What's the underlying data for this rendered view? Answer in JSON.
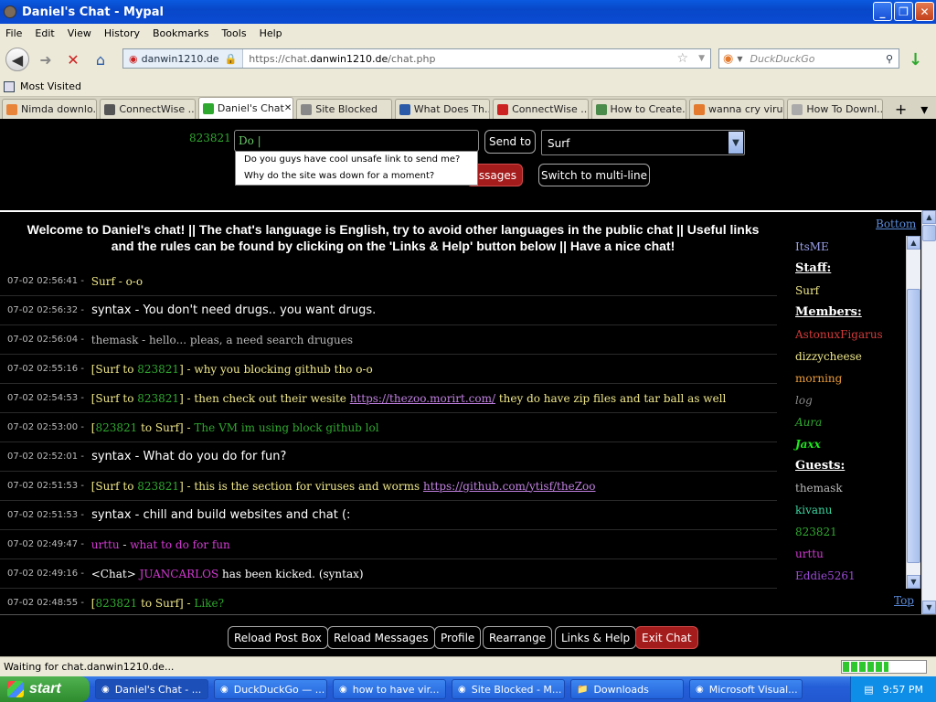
{
  "window": {
    "title": "Daniel's Chat - Mypal"
  },
  "menu": [
    "File",
    "Edit",
    "View",
    "History",
    "Bookmarks",
    "Tools",
    "Help"
  ],
  "nav": {
    "site_identity": "danwin1210.de",
    "url_prefix": "https://chat.",
    "url_domain": "danwin1210.de",
    "url_path": "/chat.php",
    "search_placeholder": "DuckDuckGo"
  },
  "bookmarks": {
    "most_visited": "Most Visited"
  },
  "tabs": [
    {
      "label": "Nimda downlo...",
      "active": false
    },
    {
      "label": "ConnectWise ...",
      "active": false
    },
    {
      "label": "Daniel's Chat",
      "active": true
    },
    {
      "label": "Site Blocked",
      "active": false
    },
    {
      "label": "What Does Th...",
      "active": false
    },
    {
      "label": "ConnectWise ...",
      "active": false
    },
    {
      "label": "How to Create...",
      "active": false
    },
    {
      "label": "wanna cry viru...",
      "active": false
    },
    {
      "label": "How To Downl...",
      "active": false
    }
  ],
  "postbox": {
    "username": "823821 :",
    "input_value": "Do |",
    "suggestions": [
      "Do you guys have cool unsafe link to send me?",
      "Why do the site was down for a moment?"
    ],
    "send_label": "Send to",
    "recipient": "Surf",
    "messages_btn": "ssages",
    "multiline_btn": "Switch to multi-line"
  },
  "welcome": "Welcome to Daniel's chat! || The chat's language is English, try to avoid other languages in the public chat || Useful links and the rules can be found by clicking on the 'Links & Help' button below || Have a nice chat!",
  "messages": [
    {
      "ts": "07-02 02:56:41 -",
      "parts": [
        {
          "t": " Surf - o-o",
          "c": "#f0e88a"
        }
      ]
    },
    {
      "ts": "07-02 02:56:32 -",
      "sans": true,
      "parts": [
        {
          "t": " syntax - You don't need drugs.. you want drugs.",
          "c": "#ffffff"
        }
      ]
    },
    {
      "ts": "07-02 02:56:04 -",
      "parts": [
        {
          "t": " themask - hello... pleas, a need search drugues",
          "c": "#b8b8b8"
        }
      ]
    },
    {
      "ts": "07-02 02:55:16 -",
      "parts": [
        {
          "t": " [Surf to ",
          "c": "#f0e88a"
        },
        {
          "t": "823821",
          "c": "#2fa82f"
        },
        {
          "t": "] - why you blocking github tho o-o",
          "c": "#f0e88a"
        }
      ]
    },
    {
      "ts": "07-02 02:54:53 -",
      "parts": [
        {
          "t": " [Surf to ",
          "c": "#f0e88a"
        },
        {
          "t": "823821",
          "c": "#2fa82f"
        },
        {
          "t": "] - then check out their wesite ",
          "c": "#f0e88a"
        },
        {
          "t": "https://thezoo.morirt.com/",
          "c": "#c080e0",
          "link": true
        },
        {
          "t": " they do have zip files and tar ball as well",
          "c": "#f0e88a"
        }
      ]
    },
    {
      "ts": "07-02 02:53:00 -",
      "parts": [
        {
          "t": " [",
          "c": "#f0e88a"
        },
        {
          "t": "823821",
          "c": "#2fa82f"
        },
        {
          "t": " to Surf] - ",
          "c": "#f0e88a"
        },
        {
          "t": "The VM im using block github lol",
          "c": "#2fa82f"
        }
      ]
    },
    {
      "ts": "07-02 02:52:01 -",
      "sans": true,
      "parts": [
        {
          "t": " syntax - What do you do for fun?",
          "c": "#ffffff"
        }
      ]
    },
    {
      "ts": "07-02 02:51:53 -",
      "parts": [
        {
          "t": " [Surf to ",
          "c": "#f0e88a"
        },
        {
          "t": "823821",
          "c": "#2fa82f"
        },
        {
          "t": "] - this is the section for viruses and worms ",
          "c": "#f0e88a"
        },
        {
          "t": "https://github.com/ytisf/theZoo",
          "c": "#c080e0",
          "link": true
        }
      ]
    },
    {
      "ts": "07-02 02:51:53 -",
      "sans": true,
      "parts": [
        {
          "t": " syntax - chill and build websites and chat (:",
          "c": "#ffffff"
        }
      ]
    },
    {
      "ts": "07-02 02:49:47 -",
      "parts": [
        {
          "t": " urttu",
          "c": "#d43ad4"
        },
        {
          "t": " - ",
          "c": "#ddd"
        },
        {
          "t": "what to do for fun",
          "c": "#d43ad4"
        }
      ]
    },
    {
      "ts": "07-02 02:49:16 -",
      "parts": [
        {
          "t": " <Chat> ",
          "c": "#ffffff"
        },
        {
          "t": "JUANCARLOS",
          "c": "#d43ad4"
        },
        {
          "t": " has been kicked. (syntax)",
          "c": "#ffffff"
        }
      ]
    },
    {
      "ts": "07-02 02:48:55 -",
      "parts": [
        {
          "t": " [",
          "c": "#f0e88a"
        },
        {
          "t": "823821",
          "c": "#2fa82f"
        },
        {
          "t": " to Surf] - ",
          "c": "#f0e88a"
        },
        {
          "t": "Like?",
          "c": "#2fa82f"
        }
      ]
    }
  ],
  "sidebar": {
    "bottom_link": "Bottom",
    "top_link": "Top",
    "users": [
      {
        "name": "ItsME",
        "color": "#9aa0e8"
      },
      {
        "name": "Staff:",
        "header": true
      },
      {
        "name": "Surf",
        "color": "#f0e88a"
      },
      {
        "name": "Members:",
        "header": true
      },
      {
        "name": "AstonuxFigarus",
        "color": "#d43a3a"
      },
      {
        "name": "dizzycheese",
        "color": "#f0e88a"
      },
      {
        "name": "morning",
        "color": "#e89a3a"
      },
      {
        "name": "log",
        "color": "#888888",
        "italic": true
      },
      {
        "name": "Aura",
        "color": "#2fa82f",
        "italic": true
      },
      {
        "name": "Jaxx",
        "color": "#1ee81e",
        "italic": true,
        "bold": true
      },
      {
        "name": "Guests:",
        "header": true
      },
      {
        "name": "themask",
        "color": "#b8b8b8"
      },
      {
        "name": "kivanu",
        "color": "#3ad4a0"
      },
      {
        "name": "823821",
        "color": "#2fa82f"
      },
      {
        "name": "urttu",
        "color": "#d43ad4"
      },
      {
        "name": "Eddie5261",
        "color": "#9a4ad4"
      }
    ]
  },
  "bottom_buttons": [
    {
      "label": "Reload Post Box",
      "red": false
    },
    {
      "label": "Reload Messages",
      "red": false
    },
    {
      "label": "Profile",
      "red": false
    },
    {
      "label": "Rearrange",
      "red": false
    },
    {
      "label": "Links & Help",
      "red": false
    },
    {
      "label": "Exit Chat",
      "red": true
    }
  ],
  "status": {
    "text": "Waiting for chat.danwin1210.de...",
    "progress": 0.55
  },
  "taskbar": {
    "start": "start",
    "tasks": [
      "Daniel's Chat - ...",
      "DuckDuckGo — ...",
      "how to have vir...",
      "Site Blocked - M...",
      "Downloads",
      "Microsoft Visual..."
    ],
    "clock": "9:57 PM"
  }
}
